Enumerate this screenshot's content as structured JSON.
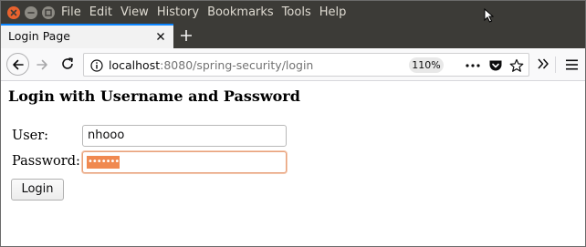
{
  "menubar": {
    "items": [
      "File",
      "Edit",
      "View",
      "History",
      "Bookmarks",
      "Tools",
      "Help"
    ]
  },
  "tab": {
    "title": "Login Page"
  },
  "urlbar": {
    "host": "localhost",
    "rest": ":8080/spring-security/login",
    "zoom": "110%"
  },
  "page": {
    "heading": "Login with Username and Password",
    "user_label": "User:",
    "user_value": "nhooo",
    "password_label": "Password:",
    "password_mask": "•••••••",
    "login_button": "Login"
  },
  "colors": {
    "accent": "#0a84ff",
    "selection": "#f08950",
    "menubar_bg": "#3c3b37"
  }
}
